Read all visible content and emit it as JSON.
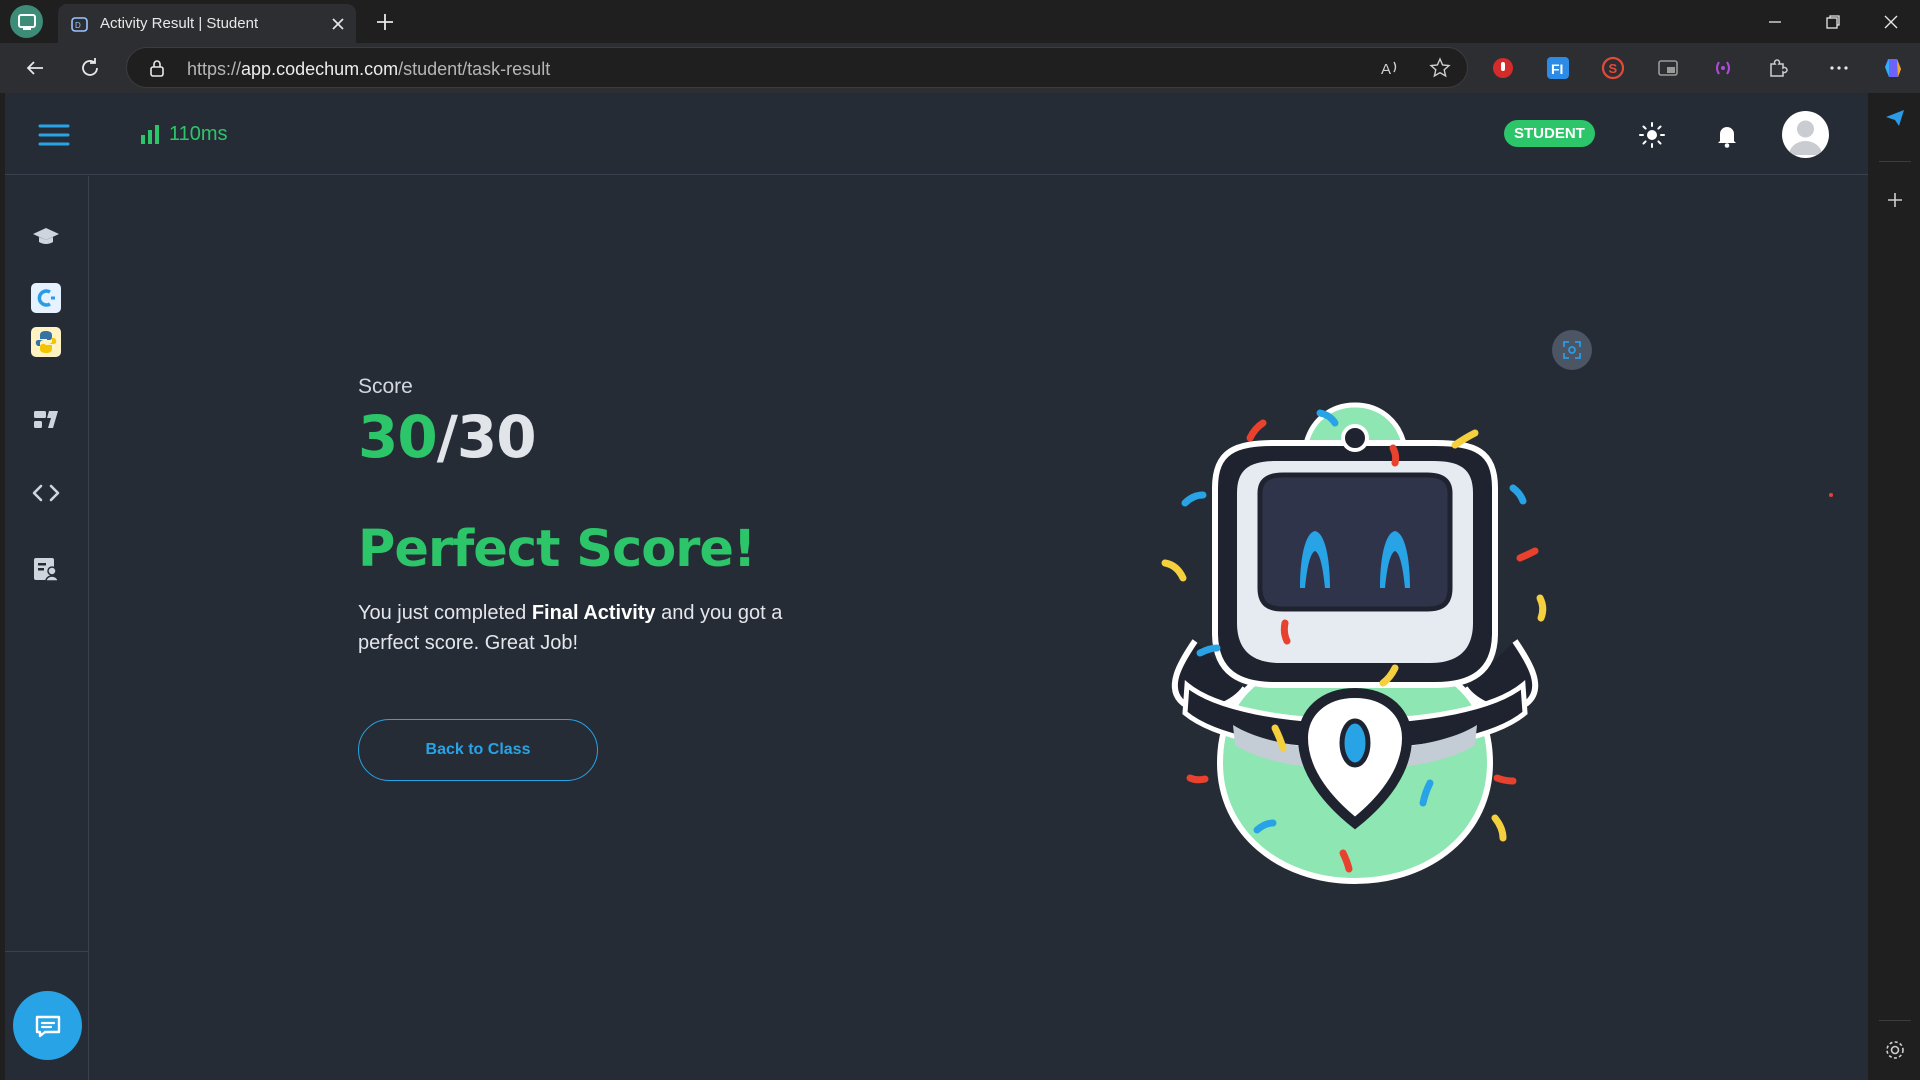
{
  "browser": {
    "tab_title": "Activity Result | Student",
    "url_prefix": "https://",
    "url_host": "app.codechum.com",
    "url_path": "/student/task-result"
  },
  "header": {
    "latency": "110ms",
    "role_badge": "STUDENT"
  },
  "sidebar": {
    "items": [
      {
        "name": "classes",
        "icon": "graduation-cap-icon"
      },
      {
        "name": "c-language",
        "icon": "c-language-icon"
      },
      {
        "name": "python-language",
        "icon": "python-icon"
      },
      {
        "name": "tasks",
        "icon": "cards-icon"
      },
      {
        "name": "playground",
        "icon": "code-icon"
      },
      {
        "name": "profile",
        "icon": "id-card-icon"
      }
    ]
  },
  "result": {
    "score_label": "Score",
    "score_got": "30",
    "score_total": "/30",
    "headline": "Perfect Score!",
    "message_pre": "You just completed ",
    "activity_name": "Final Activity",
    "message_post": " and you got a perfect score. Great Job!",
    "back_button": "Back to Class"
  },
  "colors": {
    "accent_green": "#2cc569",
    "accent_blue": "#27a3e6",
    "page_bg": "#262c36"
  }
}
